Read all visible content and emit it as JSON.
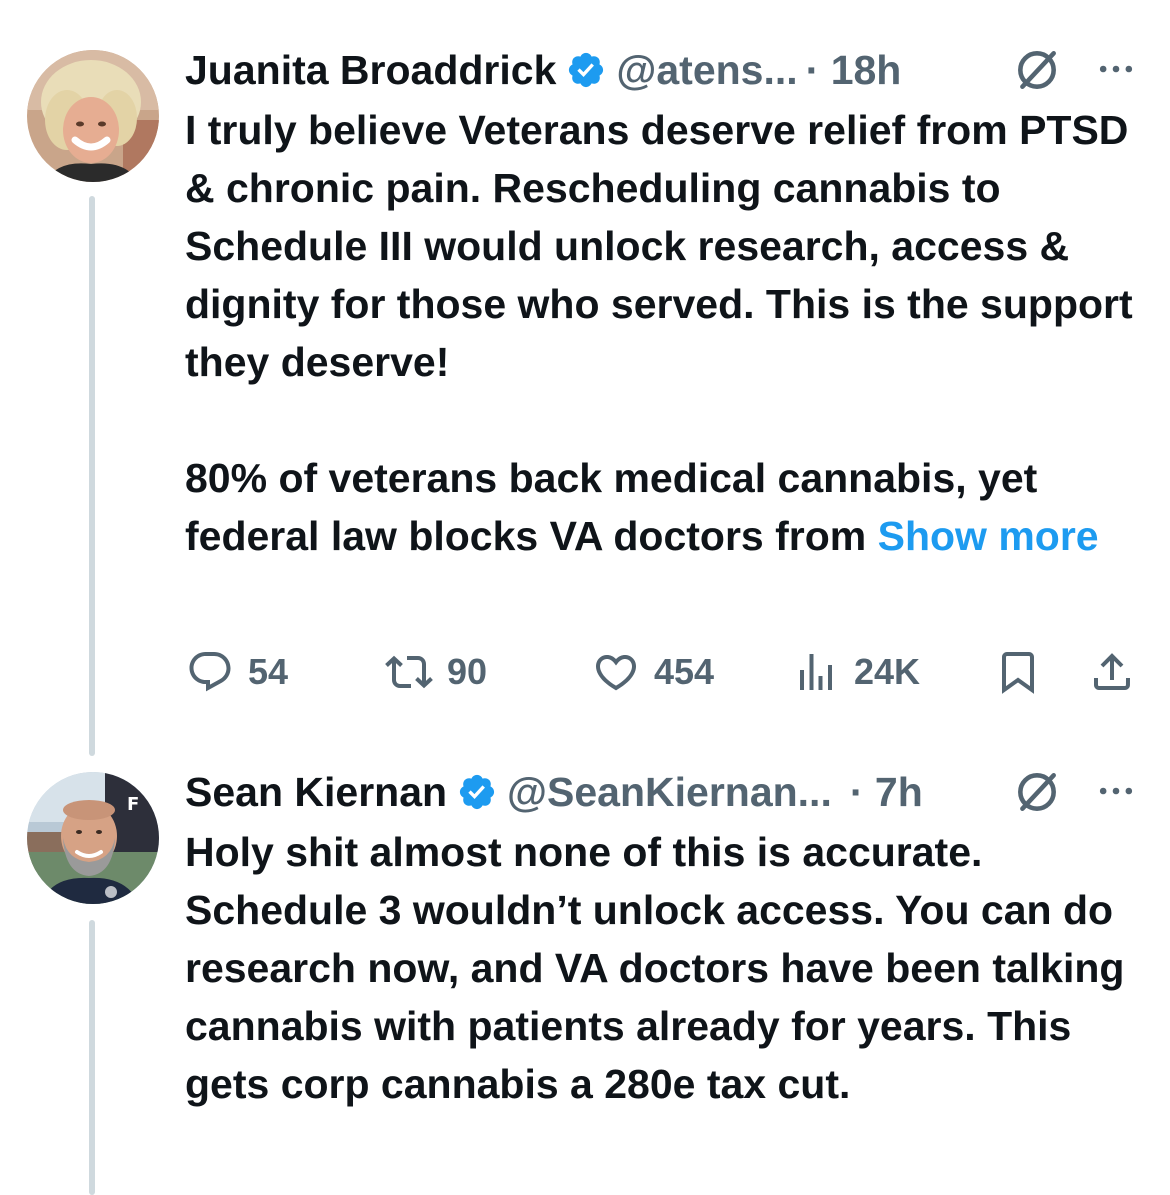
{
  "tweets": [
    {
      "name": "Juanita Broaddrick",
      "handle": "@atens...",
      "time": "· 18h",
      "text": "I truly believe Veterans deserve relief from PTSD & chronic pain. Rescheduling cannabis to Schedule III would unlock research, access & dignity for those who served.  This is the support they deserve!\n\n 80% of veterans back medical cannabis, yet federal law blocks VA doctors from ",
      "show_more": "Show more",
      "actions": {
        "replies": "54",
        "reposts": "90",
        "likes": "454",
        "views": "24K"
      },
      "icons": {
        "verified": "verified-badge-icon",
        "grok": "grok-icon",
        "more": "more-icon",
        "reply": "reply-icon",
        "repost": "repost-icon",
        "like": "heart-icon",
        "views": "views-icon",
        "bookmark": "bookmark-icon",
        "share": "share-icon"
      }
    },
    {
      "name": "Sean Kiernan",
      "handle": "@SeanKiernan...",
      "time": "· 7h",
      "text": "Holy shit almost none of this is accurate. Schedule 3 wouldn’t unlock access.  You can do research now, and VA doctors have been talking cannabis with patients already for years.  This gets corp cannabis a 280e tax cut."
    }
  ],
  "colors": {
    "text": "#0f1419",
    "secondary": "#536471",
    "link": "#1d9bf0",
    "verified": "#1d9bf0",
    "thread_line": "#cfd9de"
  }
}
